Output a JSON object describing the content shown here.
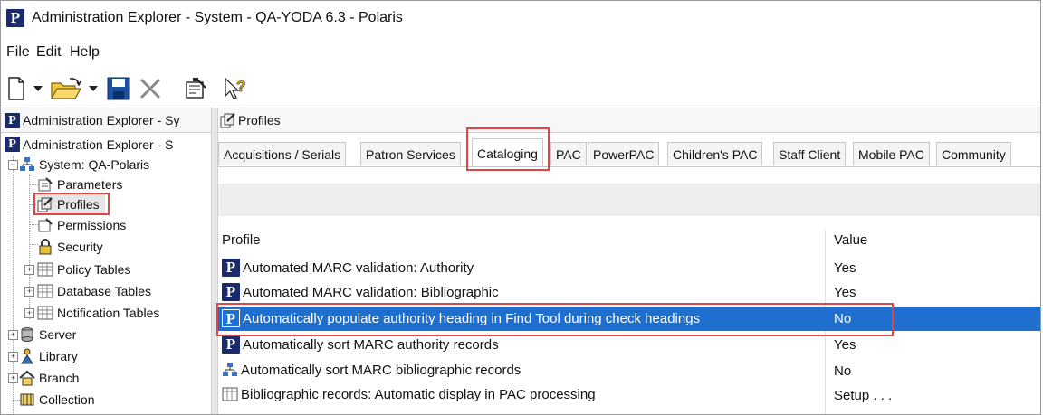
{
  "window": {
    "title": "Administration Explorer - System - QA-YODA 6.3 - Polaris"
  },
  "menu": [
    "File",
    "Edit",
    "Help"
  ],
  "toolbar": {
    "icons": [
      "new-document-icon",
      "dropdown-arrow-icon",
      "open-folder-icon",
      "dropdown-arrow-icon",
      "save-icon",
      "delete-icon",
      "properties-icon",
      "whats-this-help-icon"
    ]
  },
  "left_header": "Administration Explorer - Sy",
  "right_header": "Profiles",
  "tree": {
    "root": "Administration Explorer - S",
    "items": [
      {
        "label": "System: QA-Polaris"
      },
      {
        "label": "Parameters"
      },
      {
        "label": "Profiles"
      },
      {
        "label": "Permissions"
      },
      {
        "label": "Security"
      },
      {
        "label": "Policy Tables"
      },
      {
        "label": "Database Tables"
      },
      {
        "label": "Notification Tables"
      },
      {
        "label": "Server"
      },
      {
        "label": "Library"
      },
      {
        "label": "Branch"
      },
      {
        "label": "Collection"
      }
    ]
  },
  "tabs": [
    "Acquisitions / Serials",
    "Patron Services",
    "Cataloging",
    "PAC",
    "PowerPAC",
    "Children's PAC",
    "Staff Client",
    "Mobile PAC",
    "Community"
  ],
  "active_tab": "Cataloging",
  "list": {
    "col_profile": "Profile",
    "col_value": "Value",
    "rows": [
      {
        "profile": "Automated MARC validation: Authority",
        "value": "Yes",
        "icon": "polaris-p-icon"
      },
      {
        "profile": "Automated MARC validation: Bibliographic",
        "value": "Yes",
        "icon": "polaris-p-icon"
      },
      {
        "profile": "Automatically populate authority heading in Find Tool during check headings",
        "value": "No",
        "icon": "polaris-p-icon",
        "selected": true
      },
      {
        "profile": "Automatically sort MARC authority records",
        "value": "Yes",
        "icon": "polaris-p-icon"
      },
      {
        "profile": "Automatically sort MARC bibliographic records",
        "value": "No",
        "icon": "network-icon"
      },
      {
        "profile": "Bibliographic records: Automatic display in PAC processing",
        "value": "Setup . . .",
        "icon": "table-icon"
      }
    ]
  },
  "colors": {
    "selection": "#1e6fd0",
    "highlight_box": "#e04646",
    "polaris_blue": "#1b2a6b"
  }
}
